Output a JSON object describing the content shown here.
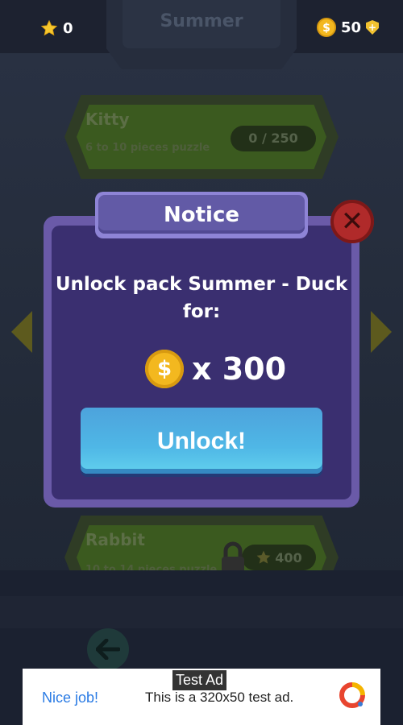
{
  "header": {
    "title": "Summer",
    "stars": "0",
    "coins": "50"
  },
  "packs": [
    {
      "name": "Kitty",
      "subtitle": "6 to 10 pieces puzzle",
      "progress": "0 / 250"
    },
    {
      "name": "Rabbit",
      "subtitle": "10 to 14 pieces puzzle",
      "cost": "400"
    }
  ],
  "dialog": {
    "title": "Notice",
    "message": "Unlock pack Summer - Duck for:",
    "price": "x 300",
    "coin_symbol": "$",
    "button": "Unlock!"
  },
  "ad": {
    "tag": "Test Ad",
    "left_text": "Nice job!",
    "message": "This is a 320x50 test ad."
  },
  "colors": {
    "dialog_fill": "#3a2f70",
    "dialog_border": "#6a5aa8",
    "button": "#4fb7e6",
    "coin": "#f3b81f",
    "close": "#b02a2a"
  }
}
